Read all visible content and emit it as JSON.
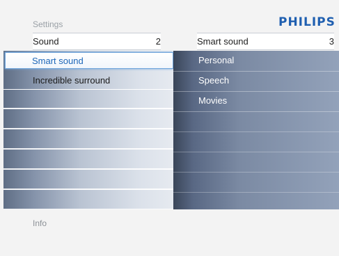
{
  "header": {
    "settings_label": "Settings",
    "brand": "PHILIPS"
  },
  "left_column": {
    "title": "Sound",
    "number": "2",
    "items": [
      {
        "label": "Smart sound",
        "selected": true
      },
      {
        "label": "Incredible surround",
        "selected": false
      }
    ]
  },
  "right_column": {
    "title": "Smart sound",
    "number": "3",
    "options": [
      {
        "label": "Personal"
      },
      {
        "label": "Speech"
      },
      {
        "label": "Movies"
      }
    ]
  },
  "info": {
    "label": "Info"
  },
  "colors": {
    "brand": "#1f5fb0",
    "selected_text": "#1c66b8",
    "selected_border": "#6fa5dc"
  }
}
